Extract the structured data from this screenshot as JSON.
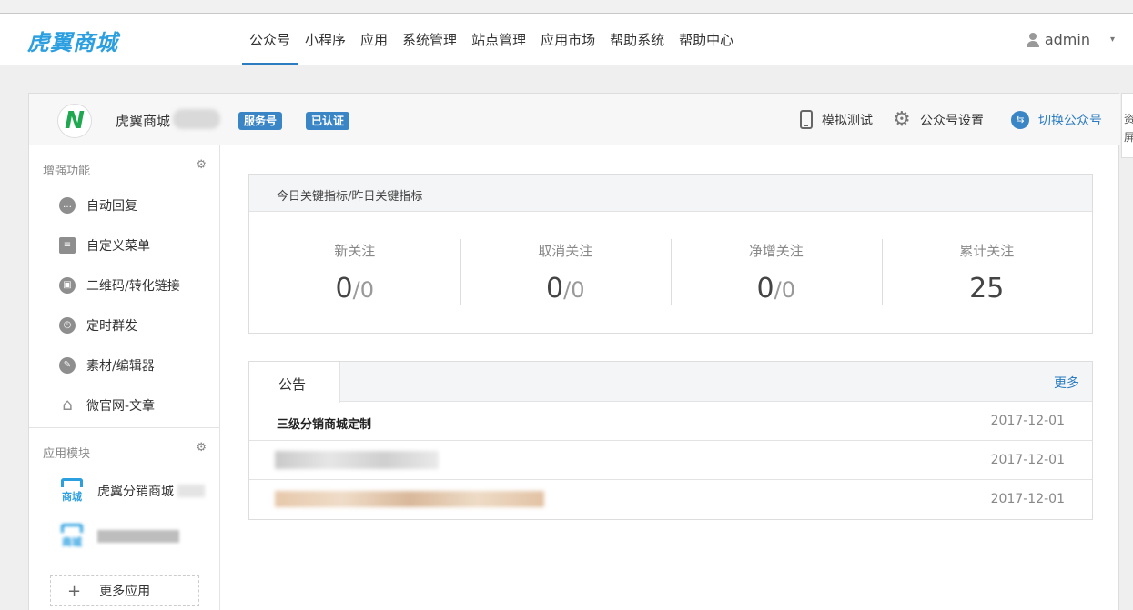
{
  "app": {
    "logo": "虎翼商城"
  },
  "nav": {
    "items": [
      {
        "label": "公众号"
      },
      {
        "label": "小程序"
      },
      {
        "label": "应用"
      },
      {
        "label": "系统管理"
      },
      {
        "label": "站点管理"
      },
      {
        "label": "应用市场"
      },
      {
        "label": "帮助系统"
      },
      {
        "label": "帮助中心"
      }
    ],
    "active_index": 0
  },
  "user": {
    "name": "admin",
    "caret": "▾"
  },
  "account": {
    "avatar_letter": "N",
    "name": "虎翼商城",
    "badge_type": "服务号",
    "badge_verified": "已认证",
    "actions": {
      "simulate": "模拟测试",
      "settings": "公众号设置",
      "switch": "切换公众号"
    }
  },
  "sidebar": {
    "enhance_title": "增强功能",
    "enhance_items": [
      {
        "label": "自动回复",
        "icon": "chat-icon"
      },
      {
        "label": "自定义菜单",
        "icon": "menu-doc-icon"
      },
      {
        "label": "二维码/转化链接",
        "icon": "qrcode-icon"
      },
      {
        "label": "定时群发",
        "icon": "clock-icon"
      },
      {
        "label": "素材/编辑器",
        "icon": "pencil-icon"
      },
      {
        "label": "微官网-文章",
        "icon": "house-icon"
      }
    ],
    "apps_title": "应用模块",
    "apps": [
      {
        "label": "虎翼分销商城"
      },
      {
        "label": ""
      }
    ],
    "app_logo_text": "商城",
    "more_apps": "更多应用",
    "more_apps_symbol": "+"
  },
  "metrics_card": {
    "title": "今日关键指标/昨日关键指标",
    "metrics": [
      {
        "label": "新关注",
        "today": "0",
        "yesterday": "0"
      },
      {
        "label": "取消关注",
        "today": "0",
        "yesterday": "0"
      },
      {
        "label": "净增关注",
        "today": "0",
        "yesterday": "0"
      },
      {
        "label": "累计关注",
        "total": "25"
      }
    ],
    "separator": "/"
  },
  "notice_card": {
    "tab": "公告",
    "more": "更多",
    "rows": [
      {
        "title": "三级分销商城定制",
        "date": "2017-12-01"
      },
      {
        "title": "",
        "date": "2017-12-01"
      },
      {
        "title": "",
        "date": "2017-12-01"
      }
    ]
  },
  "right_edge": {
    "line1": "资",
    "line2": "屏"
  },
  "colors": {
    "accent": "#2b7cc0",
    "logo": "#2b9fe0",
    "badge": "#3a85c6"
  }
}
